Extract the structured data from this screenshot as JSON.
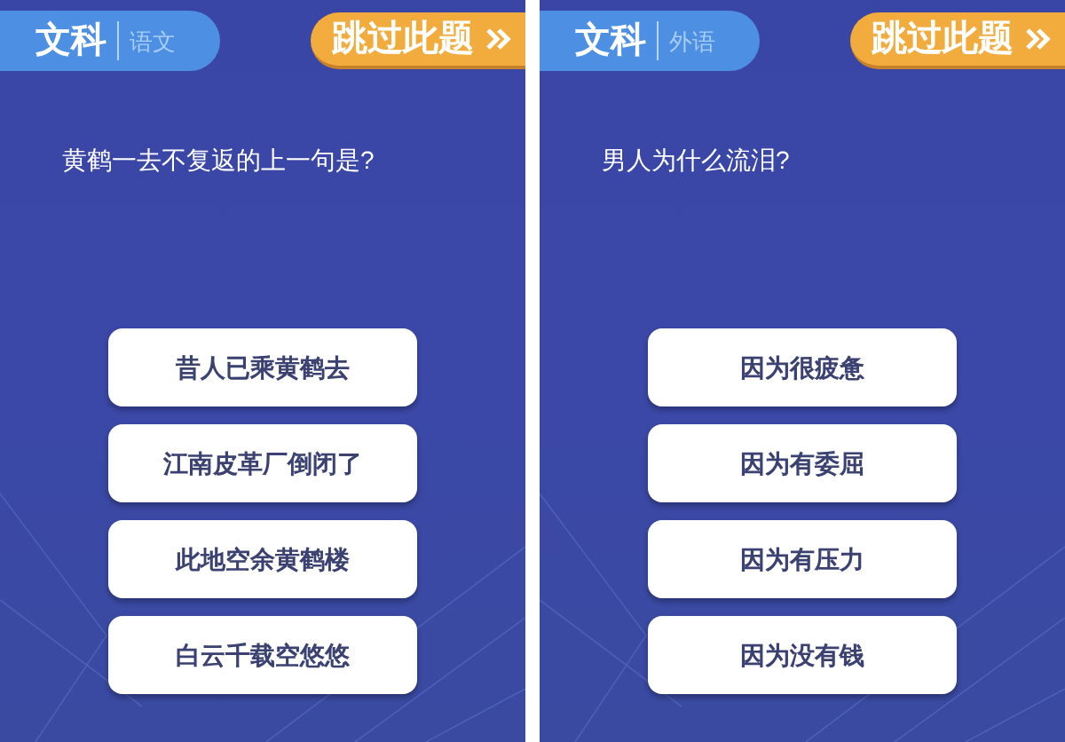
{
  "panels": [
    {
      "subject": "文科",
      "category": "语文",
      "skip": "跳过此题",
      "question": "黄鹤一去不复返的上一句是?",
      "options": [
        "昔人已乘黄鹤去",
        "江南皮革厂倒闭了",
        "此地空余黄鹤楼",
        "白云千载空悠悠"
      ]
    },
    {
      "subject": "文科",
      "category": "外语",
      "skip": "跳过此题",
      "question": "男人为什么流泪?",
      "options": [
        "因为很疲惫",
        "因为有委屈",
        "因为有压力",
        "因为没有钱"
      ]
    }
  ]
}
